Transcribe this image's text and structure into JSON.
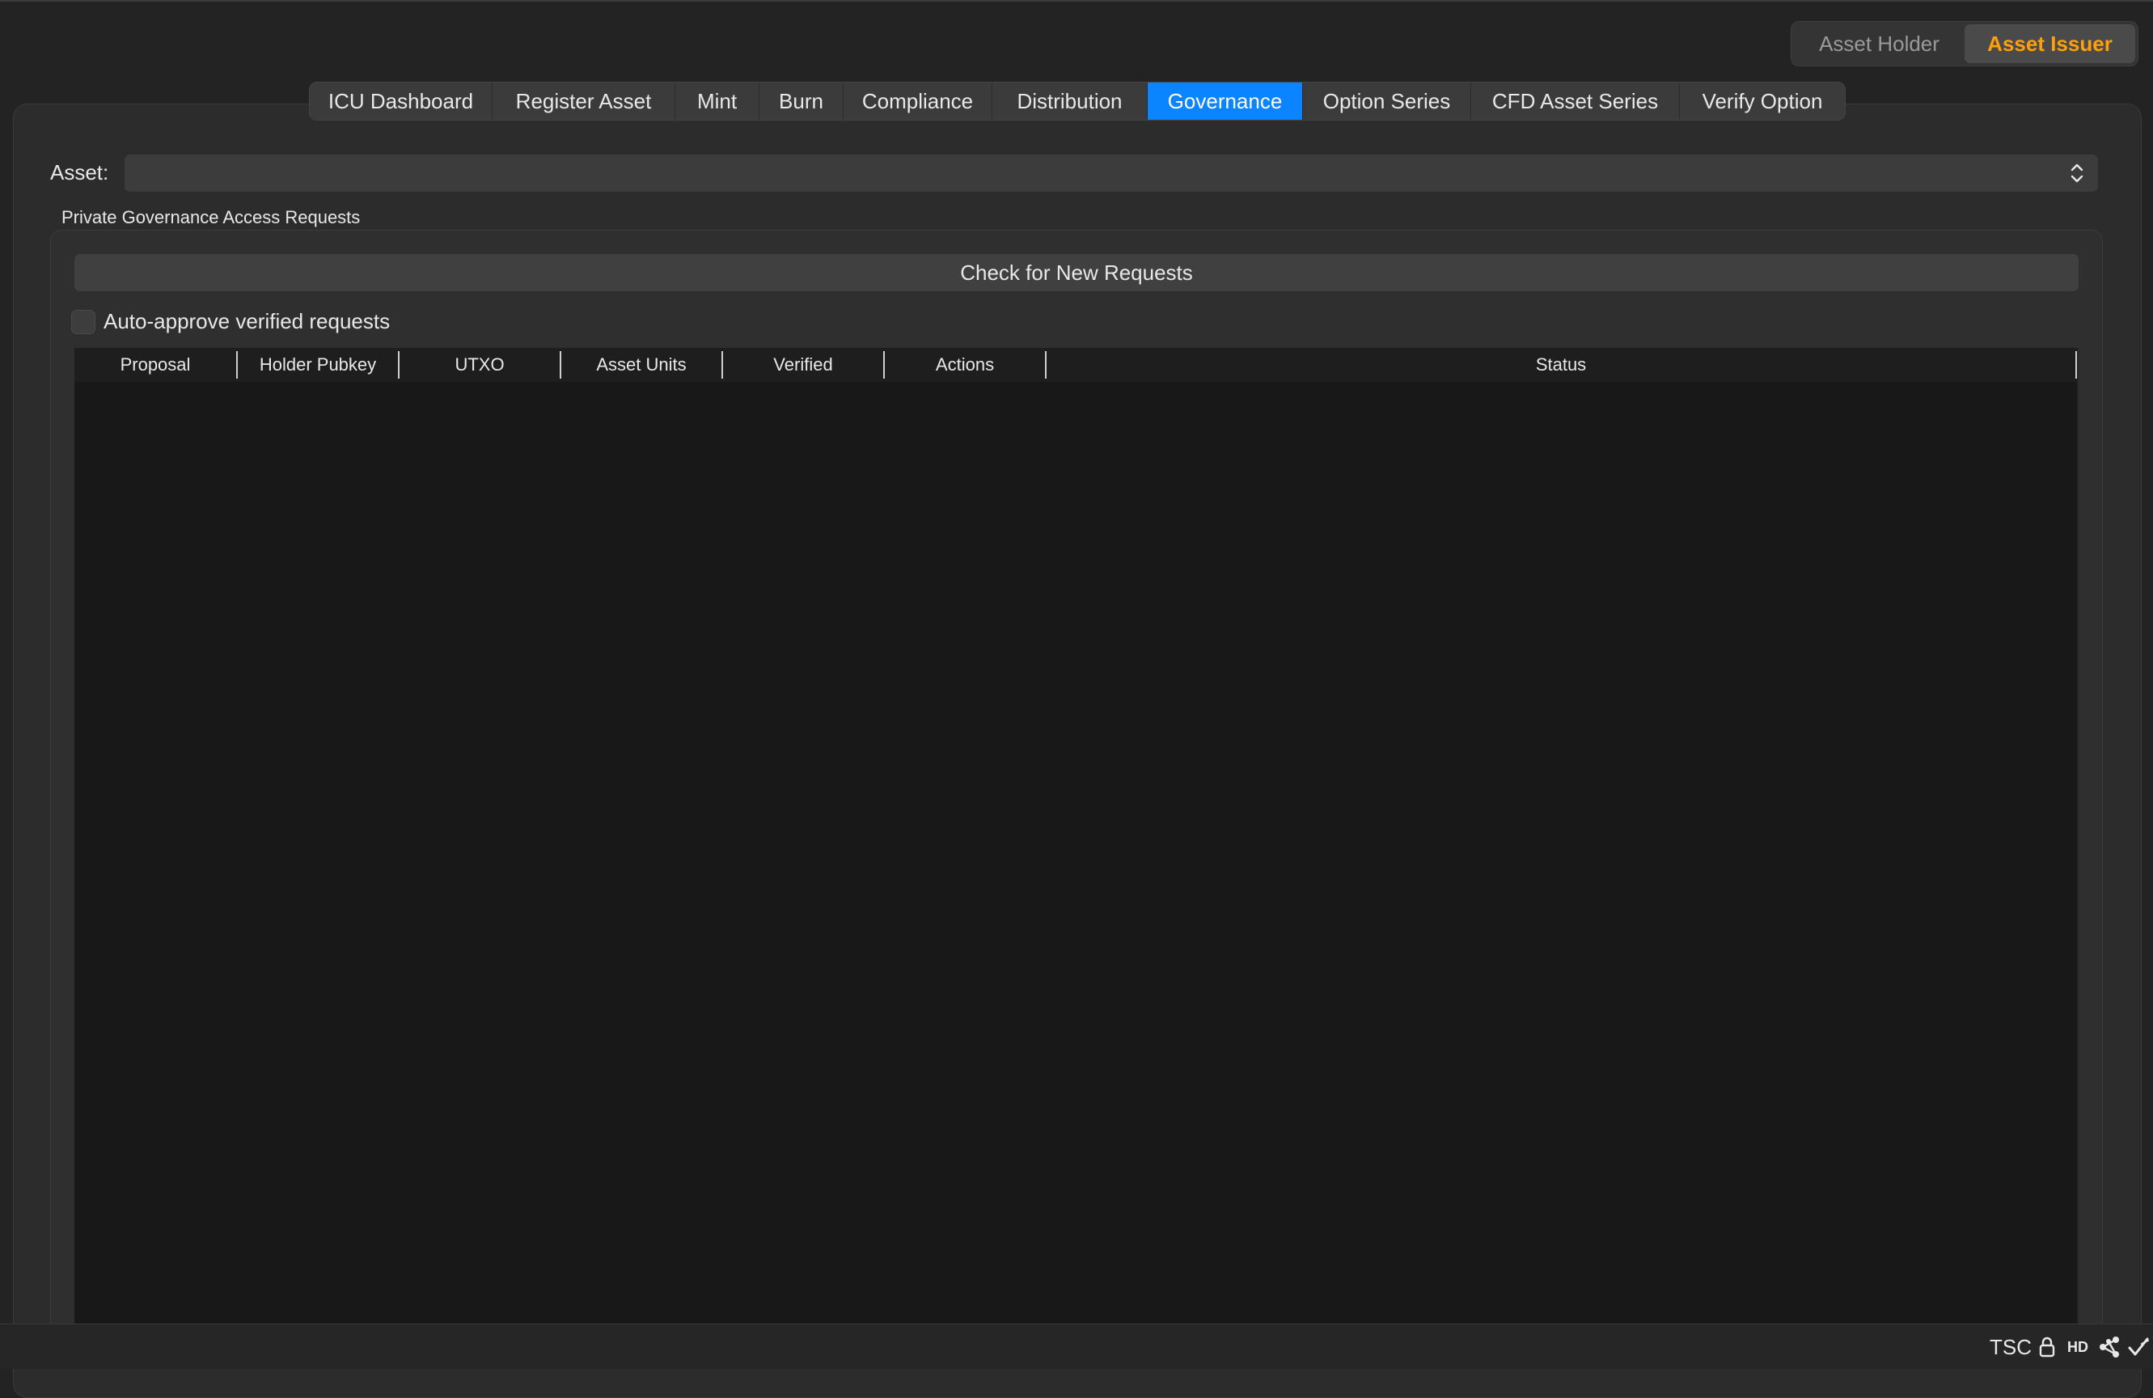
{
  "role_toggle": {
    "holder_label": "Asset Holder",
    "issuer_label": "Asset Issuer",
    "selected": "Asset Issuer",
    "accent_color": "#ff9f0a"
  },
  "tabs": [
    {
      "label": "ICU Dashboard"
    },
    {
      "label": "Register Asset"
    },
    {
      "label": "Mint"
    },
    {
      "label": "Burn"
    },
    {
      "label": "Compliance"
    },
    {
      "label": "Distribution"
    },
    {
      "label": "Governance",
      "active": true
    },
    {
      "label": "Option Series"
    },
    {
      "label": "CFD Asset Series"
    },
    {
      "label": "Verify Option"
    }
  ],
  "active_tab_color": "#0a84ff",
  "asset": {
    "label": "Asset:",
    "value": ""
  },
  "governance": {
    "group_title": "Private Governance Access Requests",
    "check_button_label": "Check for New Requests",
    "auto_approve_label": "Auto-approve verified requests",
    "auto_approve_checked": false,
    "table": {
      "columns": [
        "Proposal",
        "Holder Pubkey",
        "UTXO",
        "Asset Units",
        "Verified",
        "Actions",
        "Status"
      ],
      "rows": []
    }
  },
  "status_bar": {
    "network_label": "TSC",
    "hd_label": "HD",
    "icons": [
      "lock-icon",
      "network-icon",
      "checkmark-icon"
    ]
  }
}
